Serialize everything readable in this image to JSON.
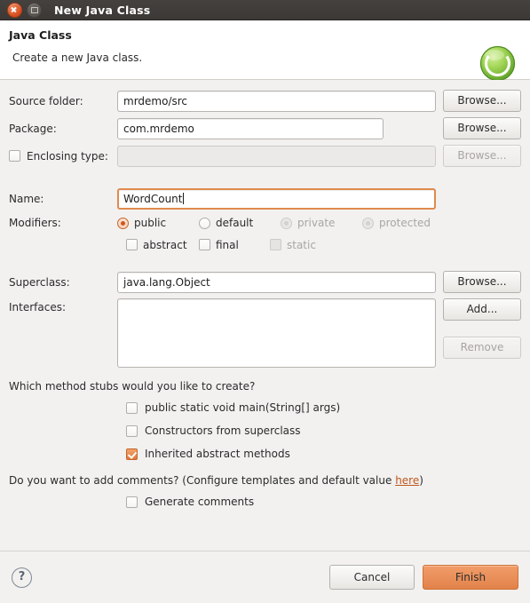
{
  "titlebar": {
    "title": "New Java Class",
    "close_icon": "close-icon",
    "minimize_icon": "minimize-icon"
  },
  "header": {
    "title": "Java Class",
    "subtitle": "Create a new Java class.",
    "icon": "java-class-icon",
    "icon_color": "#7ac143"
  },
  "form": {
    "source_folder": {
      "label": "Source folder:",
      "value": "mrdemo/src",
      "button": "Browse..."
    },
    "package": {
      "label": "Package:",
      "value": "com.mrdemo",
      "button": "Browse..."
    },
    "enclosing_type": {
      "label": "Enclosing type:",
      "value": "",
      "checked": false,
      "button": "Browse...",
      "disabled": true
    },
    "name": {
      "label": "Name:",
      "value": "WordCount",
      "focused": true
    },
    "modifiers": {
      "label": "Modifiers:",
      "radios": [
        {
          "label": "public",
          "selected": true,
          "disabled": false
        },
        {
          "label": "default",
          "selected": false,
          "disabled": false
        },
        {
          "label": "private",
          "selected": false,
          "disabled": true
        },
        {
          "label": "protected",
          "selected": false,
          "disabled": true
        }
      ],
      "checkboxes": [
        {
          "label": "abstract",
          "checked": false,
          "disabled": false
        },
        {
          "label": "final",
          "checked": false,
          "disabled": false
        },
        {
          "label": "static",
          "checked": false,
          "disabled": true
        }
      ]
    },
    "superclass": {
      "label": "Superclass:",
      "value": "java.lang.Object",
      "button": "Browse..."
    },
    "interfaces": {
      "label": "Interfaces:",
      "items": [],
      "add_button": "Add...",
      "remove_button": "Remove",
      "remove_disabled": true
    }
  },
  "stubs": {
    "question": "Which method stubs would you like to create?",
    "options": [
      {
        "label": "public static void main(String[] args)",
        "checked": false
      },
      {
        "label": "Constructors from superclass",
        "checked": false
      },
      {
        "label": "Inherited abstract methods",
        "checked": true
      }
    ]
  },
  "comments": {
    "question_prefix": "Do you want to add comments? (Configure templates and default value ",
    "link": "here",
    "question_suffix": ")",
    "option": {
      "label": "Generate comments",
      "checked": false
    }
  },
  "footer": {
    "help_icon": "help-icon",
    "cancel": "Cancel",
    "finish": "Finish",
    "finish_color": "#e8884f"
  }
}
